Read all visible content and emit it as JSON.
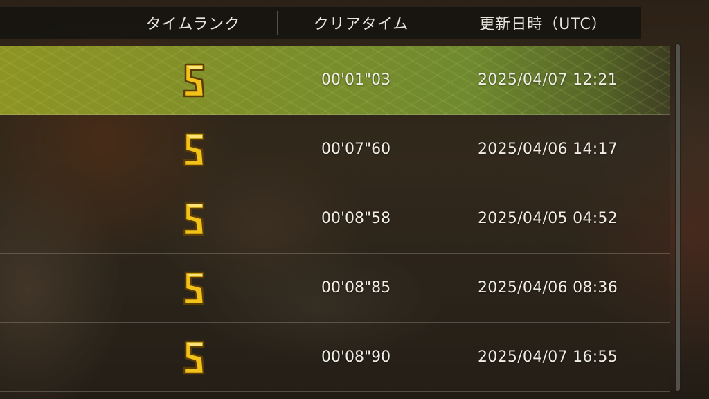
{
  "columns": {
    "rank": "タイムランク",
    "clear_time": "クリアタイム",
    "updated": "更新日時（UTC）"
  },
  "rows": [
    {
      "rank": "S",
      "time": "00'01\"03",
      "date": "2025/04/07 12:21",
      "selected": true
    },
    {
      "rank": "S",
      "time": "00'07\"60",
      "date": "2025/04/06 14:17"
    },
    {
      "rank": "S",
      "time": "00'08\"58",
      "date": "2025/04/05 04:52"
    },
    {
      "rank": "S",
      "time": "00'08\"85",
      "date": "2025/04/06 08:36"
    },
    {
      "rank": "S",
      "time": "00'08\"90",
      "date": "2025/04/07 16:55"
    }
  ],
  "colors": {
    "rank_gold": "#f2c21a",
    "selected_row": "#8e9424"
  }
}
